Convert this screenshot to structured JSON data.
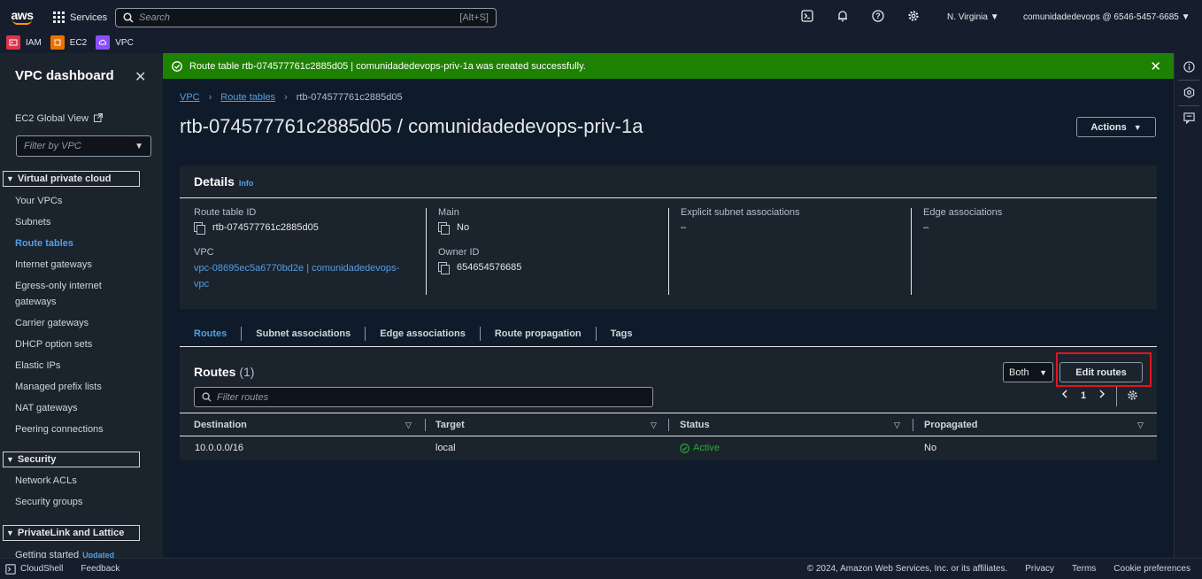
{
  "topnav": {
    "logo_text": "aws",
    "services_label": "Services",
    "search_placeholder": "Search",
    "search_shortcut": "[Alt+S]",
    "region": "N. Virginia",
    "account": "comunidadedevops @ 6546-5457-6685"
  },
  "favorites": [
    {
      "label": "IAM",
      "color": "#dd344c"
    },
    {
      "label": "EC2",
      "color": "#ed7100"
    },
    {
      "label": "VPC",
      "color": "#8c4fff"
    }
  ],
  "sidebar": {
    "title": "VPC dashboard",
    "global_view": "EC2 Global View",
    "filter_placeholder": "Filter by VPC",
    "section_vpc": "Virtual private cloud",
    "items_vpc": [
      "Your VPCs",
      "Subnets",
      "Route tables",
      "Internet gateways",
      "Egress-only internet",
      "gateways",
      "Carrier gateways",
      "DHCP option sets",
      "Elastic IPs",
      "Managed prefix lists",
      "NAT gateways",
      "Peering connections"
    ],
    "section_security": "Security",
    "items_security": [
      "Network ACLs",
      "Security groups"
    ],
    "section_privatelink": "PrivateLink and Lattice",
    "getting_started": "Getting started",
    "updated_badge": "Updated"
  },
  "flash": {
    "message": "Route table rtb-074577761c2885d05 | comunidadedevops-priv-1a was created successfully."
  },
  "breadcrumb": {
    "vpc": "VPC",
    "route_tables": "Route tables",
    "current": "rtb-074577761c2885d05"
  },
  "page": {
    "title": "rtb-074577761c2885d05 / comunidadedevops-priv-1a",
    "actions_label": "Actions"
  },
  "details": {
    "heading": "Details",
    "info": "Info",
    "route_table_id_label": "Route table ID",
    "route_table_id": "rtb-074577761c2885d05",
    "vpc_label": "VPC",
    "vpc_line1": "vpc-08695ec5a6770bd2e | comunidadedevops-",
    "vpc_line2": "vpc",
    "main_label": "Main",
    "main_value": "No",
    "owner_label": "Owner ID",
    "owner_value": "654654576685",
    "explicit_label": "Explicit subnet associations",
    "explicit_value": "–",
    "edge_label": "Edge associations",
    "edge_value": "–"
  },
  "tabs": [
    "Routes",
    "Subnet associations",
    "Edge associations",
    "Route propagation",
    "Tags"
  ],
  "routes": {
    "title": "Routes",
    "count": "(1)",
    "filter_placeholder": "Filter routes",
    "dropdown_value": "Both",
    "edit_label": "Edit routes",
    "page_number": "1",
    "columns": [
      "Destination",
      "Target",
      "Status",
      "Propagated"
    ],
    "rows": [
      {
        "destination": "10.0.0.0/16",
        "target": "local",
        "status": "Active",
        "propagated": "No"
      }
    ]
  },
  "footer": {
    "cloudshell": "CloudShell",
    "feedback": "Feedback",
    "copyright": "© 2024, Amazon Web Services, Inc. or its affiliates.",
    "privacy": "Privacy",
    "terms": "Terms",
    "cookies": "Cookie preferences"
  },
  "colors": {
    "success": "#1d8102",
    "link": "#539fe5",
    "highlight": "#e3141d",
    "active_status": "#29ad32"
  }
}
